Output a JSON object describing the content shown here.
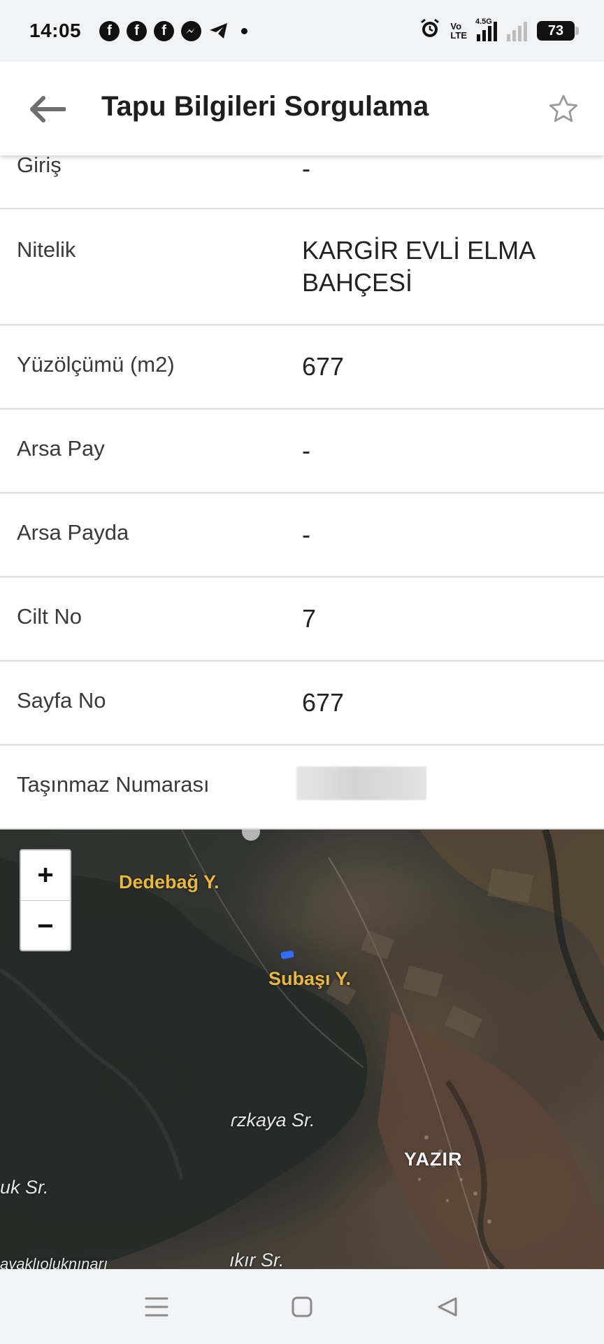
{
  "status_bar": {
    "time": "14:05",
    "notification_icons": [
      "facebook-icon",
      "facebook-icon",
      "facebook-icon",
      "messenger-icon",
      "telegram-icon",
      "dot-icon"
    ],
    "volte_label_top": "Vo",
    "volte_label_bottom": "LTE",
    "network_label": "4.5G",
    "battery": "73"
  },
  "header": {
    "title": "Tapu Bilgileri Sorgulama",
    "back_icon": "back-arrow-icon",
    "favorite_icon": "star-outline-icon"
  },
  "details": [
    {
      "label": "Giriş",
      "value": "-"
    },
    {
      "label": "Nitelik",
      "value": "KARGİR EVLİ ELMA BAHÇESİ"
    },
    {
      "label": "Yüzölçümü (m2)",
      "value": "677"
    },
    {
      "label": "Arsa Pay",
      "value": "-"
    },
    {
      "label": "Arsa Payda",
      "value": "-"
    },
    {
      "label": "Cilt No",
      "value": "7"
    },
    {
      "label": "Sayfa No",
      "value": "677"
    },
    {
      "label": "Taşınmaz Numarası",
      "value": ""
    }
  ],
  "map": {
    "zoom_in": "+",
    "zoom_out": "−",
    "labels": {
      "dedebag": "Dedebağ Y.",
      "subasi": "Subaşı Y.",
      "kaya": "ɾzkaya Sr.",
      "yazir": "YAZIR",
      "uk": "uk Sr.",
      "kir": "ıkır Sr.",
      "bottom_left": "ayaklıoluknınarı"
    },
    "marker_color": "#2f6fff"
  },
  "nav_bar": {
    "icons": [
      "menu-icon",
      "home-square-icon",
      "back-triangle-icon"
    ]
  }
}
